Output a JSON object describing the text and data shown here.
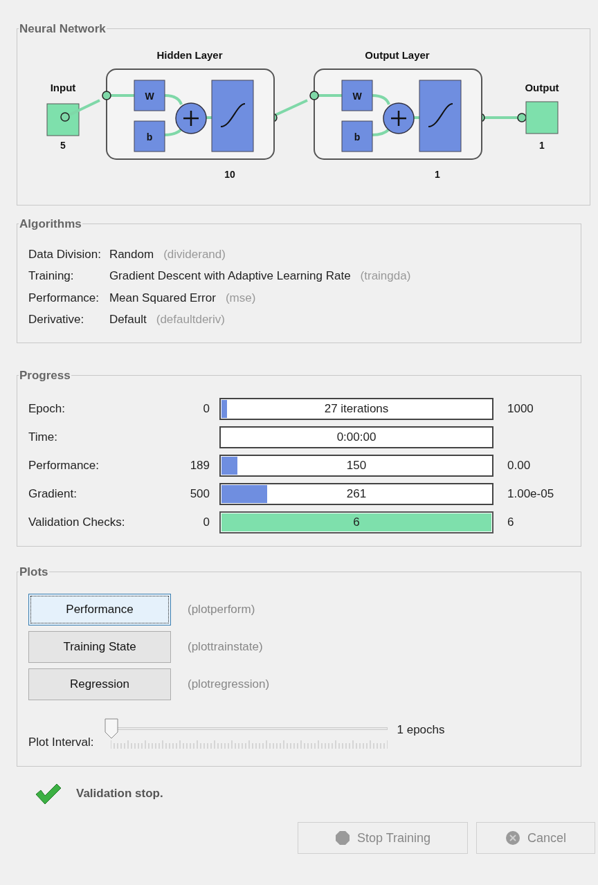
{
  "network": {
    "title": "Neural Network",
    "input": {
      "label": "Input",
      "size": "5"
    },
    "layers": [
      {
        "title": "Hidden Layer",
        "weight": "W",
        "bias": "b",
        "size": "10"
      },
      {
        "title": "Output Layer",
        "weight": "W",
        "bias": "b",
        "size": "1"
      }
    ],
    "output": {
      "label": "Output",
      "size": "1"
    }
  },
  "algorithms": {
    "title": "Algorithms",
    "rows": [
      {
        "label": "Data Division:",
        "value": "Random",
        "function": "(dividerand)"
      },
      {
        "label": "Training:",
        "value": "Gradient Descent with Adaptive Learning Rate",
        "function": "(traingda)"
      },
      {
        "label": "Performance:",
        "value": "Mean Squared Error",
        "function": "(mse)"
      },
      {
        "label": "Derivative:",
        "value": "Default",
        "function": "(defaultderiv)"
      }
    ]
  },
  "progress": {
    "title": "Progress",
    "rows": [
      {
        "kind": "progress",
        "label": "Epoch:",
        "start": "0",
        "text": "27 iterations",
        "end": "1000",
        "level": 0.02
      },
      {
        "kind": "progress",
        "label": "Time:",
        "text": "0:00:00",
        "level": 0
      },
      {
        "kind": "progress",
        "label": "Performance:",
        "start": "189",
        "text": "150",
        "end": "0.00",
        "level": 0.06
      },
      {
        "kind": "progress",
        "label": "Gradient:",
        "start": "500",
        "text": "261",
        "end": "1.00e-05",
        "level": 0.17
      },
      {
        "kind": "check",
        "label": "Validation Checks:",
        "start": "0",
        "text": "6",
        "end": "6",
        "level": 1
      }
    ]
  },
  "plots": {
    "title": "Plots",
    "buttons": [
      {
        "label": "Performance",
        "function": "(plotperform)",
        "selected": true
      },
      {
        "label": "Training State",
        "function": "(plottrainstate)",
        "selected": false
      },
      {
        "label": "Regression",
        "function": "(plotregression)",
        "selected": false
      }
    ],
    "interval": {
      "label": "Plot Interval:",
      "level": 0,
      "reading": "1 epochs"
    }
  },
  "status": "Validation stop.",
  "buttons": [
    {
      "kind": "stop",
      "label": "Stop Training",
      "disabled": true
    },
    {
      "kind": "cancel",
      "label": "Cancel",
      "disabled": true
    }
  ]
}
